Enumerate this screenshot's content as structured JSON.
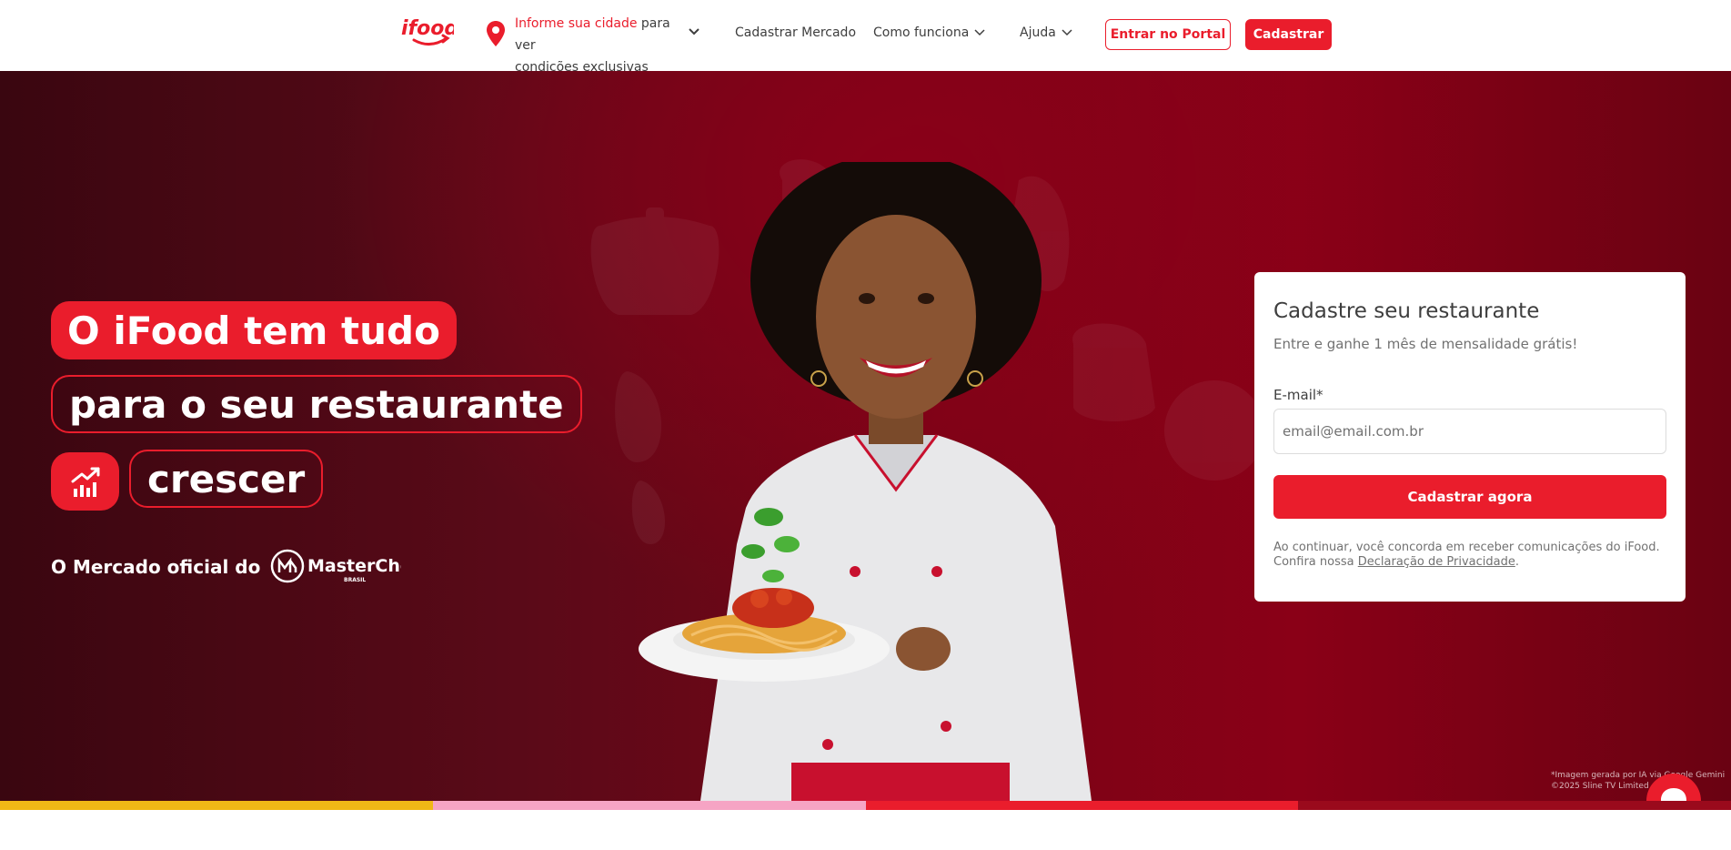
{
  "header": {
    "logo_text": "ifood",
    "location": {
      "highlight": "Informe sua cidade",
      "rest_line1": "para ver",
      "line2": "condições exclusivas",
      "icon": "map-pin-icon"
    },
    "nav": {
      "register_market": "Cadastrar Mercado",
      "how_it_works": "Como funciona",
      "help": "Ajuda"
    },
    "portal_button": "Entrar no Portal",
    "register_button": "Cadastrar"
  },
  "hero": {
    "line1": "O iFood tem tudo",
    "line2": "para o seu restaurante",
    "line3": "crescer",
    "growth_icon": "growth-chart-icon",
    "masterchef_prefix": "O Mercado oficial do",
    "masterchef_logo_text": "MasterChef",
    "masterchef_logo_sub": "BRASIL",
    "credit_line1": "*Imagem gerada por IA via Google Gemini",
    "credit_line2": "©2025 Sline TV Limited"
  },
  "signup": {
    "title": "Cadastre seu restaurante",
    "subtitle": "Entre e ganhe 1 mês de mensalidade grátis!",
    "email_label": "E-mail*",
    "email_placeholder": "email@email.com.br",
    "email_value": "",
    "submit_button": "Cadastrar agora",
    "legal_text": "Ao continuar, você concorda em receber comunicações do iFood. Confira nossa",
    "privacy_link": "Declaração de Privacidade",
    "legal_end": "."
  },
  "colors": {
    "brand_red": "#ea1d2c",
    "stripe": [
      "#f0b816",
      "#f6a4c4",
      "#ea1d2c",
      "#9a0a1c"
    ]
  },
  "chat": {
    "icon": "chat-bubble-icon"
  }
}
